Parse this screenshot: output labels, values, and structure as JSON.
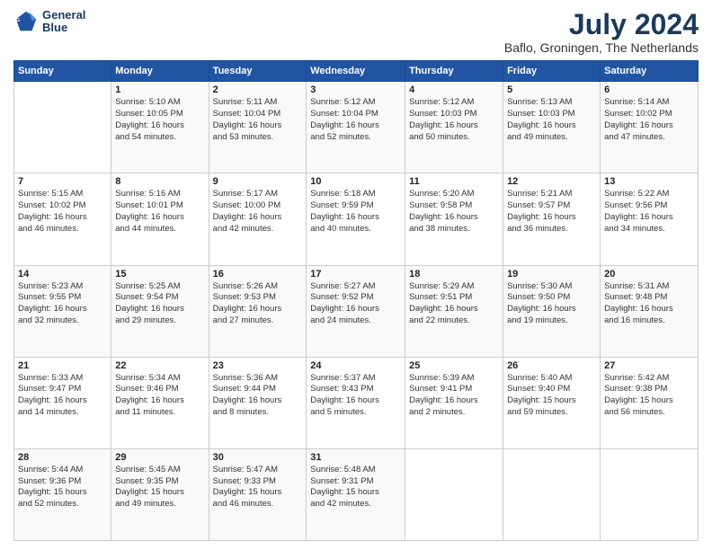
{
  "header": {
    "logo_line1": "General",
    "logo_line2": "Blue",
    "month": "July 2024",
    "location": "Baflo, Groningen, The Netherlands"
  },
  "weekdays": [
    "Sunday",
    "Monday",
    "Tuesday",
    "Wednesday",
    "Thursday",
    "Friday",
    "Saturday"
  ],
  "weeks": [
    [
      {
        "day": "",
        "detail": ""
      },
      {
        "day": "1",
        "detail": "Sunrise: 5:10 AM\nSunset: 10:05 PM\nDaylight: 16 hours\nand 54 minutes."
      },
      {
        "day": "2",
        "detail": "Sunrise: 5:11 AM\nSunset: 10:04 PM\nDaylight: 16 hours\nand 53 minutes."
      },
      {
        "day": "3",
        "detail": "Sunrise: 5:12 AM\nSunset: 10:04 PM\nDaylight: 16 hours\nand 52 minutes."
      },
      {
        "day": "4",
        "detail": "Sunrise: 5:12 AM\nSunset: 10:03 PM\nDaylight: 16 hours\nand 50 minutes."
      },
      {
        "day": "5",
        "detail": "Sunrise: 5:13 AM\nSunset: 10:03 PM\nDaylight: 16 hours\nand 49 minutes."
      },
      {
        "day": "6",
        "detail": "Sunrise: 5:14 AM\nSunset: 10:02 PM\nDaylight: 16 hours\nand 47 minutes."
      }
    ],
    [
      {
        "day": "7",
        "detail": "Sunrise: 5:15 AM\nSunset: 10:02 PM\nDaylight: 16 hours\nand 46 minutes."
      },
      {
        "day": "8",
        "detail": "Sunrise: 5:16 AM\nSunset: 10:01 PM\nDaylight: 16 hours\nand 44 minutes."
      },
      {
        "day": "9",
        "detail": "Sunrise: 5:17 AM\nSunset: 10:00 PM\nDaylight: 16 hours\nand 42 minutes."
      },
      {
        "day": "10",
        "detail": "Sunrise: 5:18 AM\nSunset: 9:59 PM\nDaylight: 16 hours\nand 40 minutes."
      },
      {
        "day": "11",
        "detail": "Sunrise: 5:20 AM\nSunset: 9:58 PM\nDaylight: 16 hours\nand 38 minutes."
      },
      {
        "day": "12",
        "detail": "Sunrise: 5:21 AM\nSunset: 9:57 PM\nDaylight: 16 hours\nand 36 minutes."
      },
      {
        "day": "13",
        "detail": "Sunrise: 5:22 AM\nSunset: 9:56 PM\nDaylight: 16 hours\nand 34 minutes."
      }
    ],
    [
      {
        "day": "14",
        "detail": "Sunrise: 5:23 AM\nSunset: 9:55 PM\nDaylight: 16 hours\nand 32 minutes."
      },
      {
        "day": "15",
        "detail": "Sunrise: 5:25 AM\nSunset: 9:54 PM\nDaylight: 16 hours\nand 29 minutes."
      },
      {
        "day": "16",
        "detail": "Sunrise: 5:26 AM\nSunset: 9:53 PM\nDaylight: 16 hours\nand 27 minutes."
      },
      {
        "day": "17",
        "detail": "Sunrise: 5:27 AM\nSunset: 9:52 PM\nDaylight: 16 hours\nand 24 minutes."
      },
      {
        "day": "18",
        "detail": "Sunrise: 5:29 AM\nSunset: 9:51 PM\nDaylight: 16 hours\nand 22 minutes."
      },
      {
        "day": "19",
        "detail": "Sunrise: 5:30 AM\nSunset: 9:50 PM\nDaylight: 16 hours\nand 19 minutes."
      },
      {
        "day": "20",
        "detail": "Sunrise: 5:31 AM\nSunset: 9:48 PM\nDaylight: 16 hours\nand 16 minutes."
      }
    ],
    [
      {
        "day": "21",
        "detail": "Sunrise: 5:33 AM\nSunset: 9:47 PM\nDaylight: 16 hours\nand 14 minutes."
      },
      {
        "day": "22",
        "detail": "Sunrise: 5:34 AM\nSunset: 9:46 PM\nDaylight: 16 hours\nand 11 minutes."
      },
      {
        "day": "23",
        "detail": "Sunrise: 5:36 AM\nSunset: 9:44 PM\nDaylight: 16 hours\nand 8 minutes."
      },
      {
        "day": "24",
        "detail": "Sunrise: 5:37 AM\nSunset: 9:43 PM\nDaylight: 16 hours\nand 5 minutes."
      },
      {
        "day": "25",
        "detail": "Sunrise: 5:39 AM\nSunset: 9:41 PM\nDaylight: 16 hours\nand 2 minutes."
      },
      {
        "day": "26",
        "detail": "Sunrise: 5:40 AM\nSunset: 9:40 PM\nDaylight: 15 hours\nand 59 minutes."
      },
      {
        "day": "27",
        "detail": "Sunrise: 5:42 AM\nSunset: 9:38 PM\nDaylight: 15 hours\nand 56 minutes."
      }
    ],
    [
      {
        "day": "28",
        "detail": "Sunrise: 5:44 AM\nSunset: 9:36 PM\nDaylight: 15 hours\nand 52 minutes."
      },
      {
        "day": "29",
        "detail": "Sunrise: 5:45 AM\nSunset: 9:35 PM\nDaylight: 15 hours\nand 49 minutes."
      },
      {
        "day": "30",
        "detail": "Sunrise: 5:47 AM\nSunset: 9:33 PM\nDaylight: 15 hours\nand 46 minutes."
      },
      {
        "day": "31",
        "detail": "Sunrise: 5:48 AM\nSunset: 9:31 PM\nDaylight: 15 hours\nand 42 minutes."
      },
      {
        "day": "",
        "detail": ""
      },
      {
        "day": "",
        "detail": ""
      },
      {
        "day": "",
        "detail": ""
      }
    ]
  ]
}
